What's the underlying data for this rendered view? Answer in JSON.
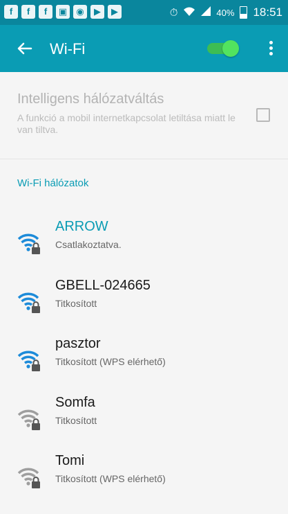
{
  "status_bar": {
    "left_icons": [
      "f",
      "f",
      "f",
      "image",
      "hotspot",
      "screencast",
      "screencast"
    ],
    "battery": "40%",
    "time": "18:51"
  },
  "toolbar": {
    "title": "Wi-Fi",
    "toggle_on": true,
    "accent": "#0a9cb4"
  },
  "smart_switch": {
    "title": "Intelligens hálózatváltás",
    "description": "A funkció a mobil internetkapcsolat letiltása miatt le van tiltva.",
    "checked": false
  },
  "networks_section": {
    "title": "Wi-Fi hálózatok"
  },
  "networks": [
    {
      "ssid": "ARROW",
      "status": "Csatlakoztatva.",
      "connected": true,
      "signal_color": "#1d8bd9"
    },
    {
      "ssid": "GBELL-024665",
      "status": "Titkosított",
      "connected": false,
      "signal_color": "#1d8bd9"
    },
    {
      "ssid": "pasztor",
      "status": "Titkosított (WPS elérhető)",
      "connected": false,
      "signal_color": "#1d8bd9"
    },
    {
      "ssid": "Somfa",
      "status": "Titkosított",
      "connected": false,
      "signal_color": "#9e9e9e"
    },
    {
      "ssid": "Tomi",
      "status": "Titkosított (WPS elérhető)",
      "connected": false,
      "signal_color": "#9e9e9e"
    }
  ]
}
